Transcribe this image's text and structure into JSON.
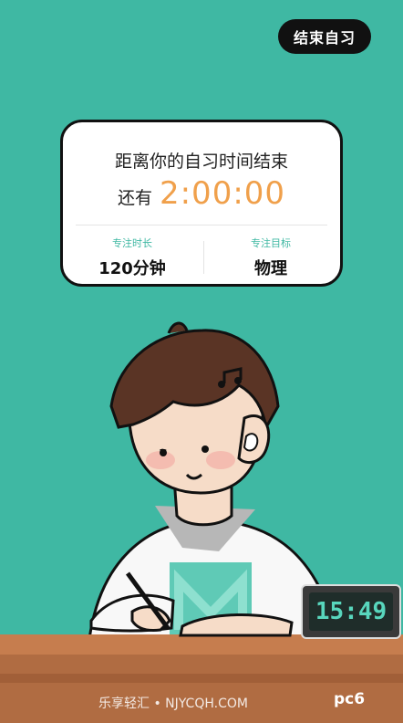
{
  "header": {
    "end_button_label": "结束自习"
  },
  "card": {
    "line1": "距离你的自习时间结束",
    "line2_prefix": "还有",
    "countdown": "2:00:00",
    "stats": [
      {
        "label": "专注时长",
        "value": "120分钟"
      },
      {
        "label": "专注目标",
        "value": "物理"
      }
    ]
  },
  "desk_clock": {
    "time": "15:49"
  },
  "footer": {
    "watermark": "乐享轻汇 • NJYCQH.COM",
    "logo": "pc6"
  },
  "colors": {
    "background": "#3fb8a3",
    "accent_orange": "#f0a04b",
    "accent_teal": "#3fb8a3"
  },
  "icons": [
    "music-note-icon"
  ]
}
